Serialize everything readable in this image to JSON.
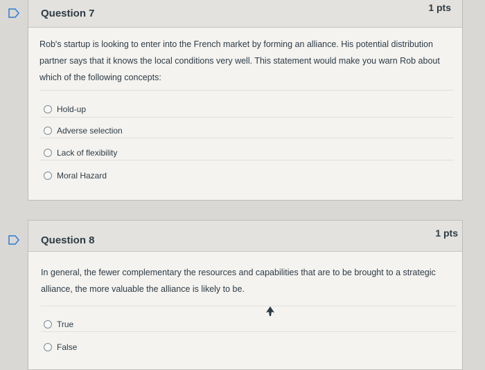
{
  "question7": {
    "title": "Question 7",
    "points": "1 pts",
    "text": "Rob's startup is looking to enter into the French market by forming an alliance. His potential distribution partner says that it knows the local conditions very well. This statement would make you warn Rob about which of the following concepts:",
    "answers": [
      "Hold-up",
      "Adverse selection",
      "Lack of flexibility",
      "Moral Hazard"
    ]
  },
  "question8": {
    "title": "Question 8",
    "points": "1 pts",
    "text": "In general, the fewer complementary the resources and capabilities that are to be brought to a strategic alliance, the more valuable the alliance is likely to be.",
    "answers": [
      "True",
      "False"
    ]
  },
  "icons": {
    "flag": "flag-icon",
    "radio": "radio-icon",
    "cursor": "mouse-cursor-icon"
  },
  "colors": {
    "flag_stroke": "#2c7bd4"
  }
}
